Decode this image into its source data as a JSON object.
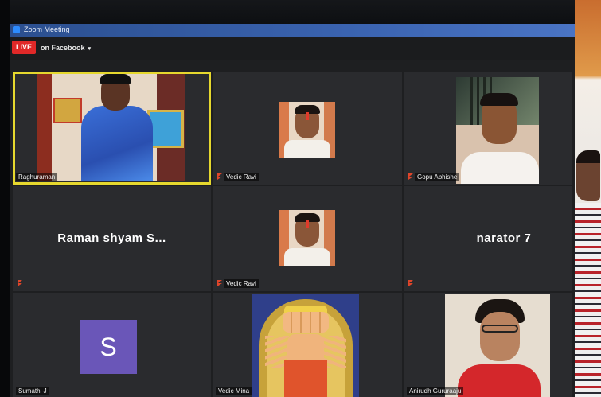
{
  "window": {
    "title": "Zoom Meeting"
  },
  "live": {
    "badge": "LIVE",
    "destination": "on Facebook",
    "caret": "▾"
  },
  "participants": [
    {
      "name": "Raghuraman",
      "active": true,
      "muted": false,
      "view": "video"
    },
    {
      "name": "Vedic Ravi",
      "active": false,
      "muted": true,
      "view": "video"
    },
    {
      "name": "Gopu Abhishe",
      "active": false,
      "muted": true,
      "view": "video"
    },
    {
      "name": "",
      "display_text": "Raman shyam S...",
      "active": false,
      "muted": true,
      "view": "name"
    },
    {
      "name": "Vedic Ravi",
      "active": false,
      "muted": true,
      "view": "video"
    },
    {
      "name": "",
      "display_text": "narator 7",
      "active": false,
      "muted": true,
      "view": "name"
    },
    {
      "name": "Sumathi J",
      "avatar_letter": "S",
      "active": false,
      "muted": false,
      "view": "avatar"
    },
    {
      "name": "Vedic Mina",
      "active": false,
      "muted": false,
      "view": "image"
    },
    {
      "name": "Anirudh Gururaaju",
      "active": false,
      "muted": false,
      "view": "video"
    }
  ],
  "colors": {
    "active_border": "#e6d82e",
    "live_red": "#e02828",
    "mute_red": "#e0452a",
    "avatar_purple": "#6a56b8",
    "tile_bg": "#2a2b2e"
  }
}
